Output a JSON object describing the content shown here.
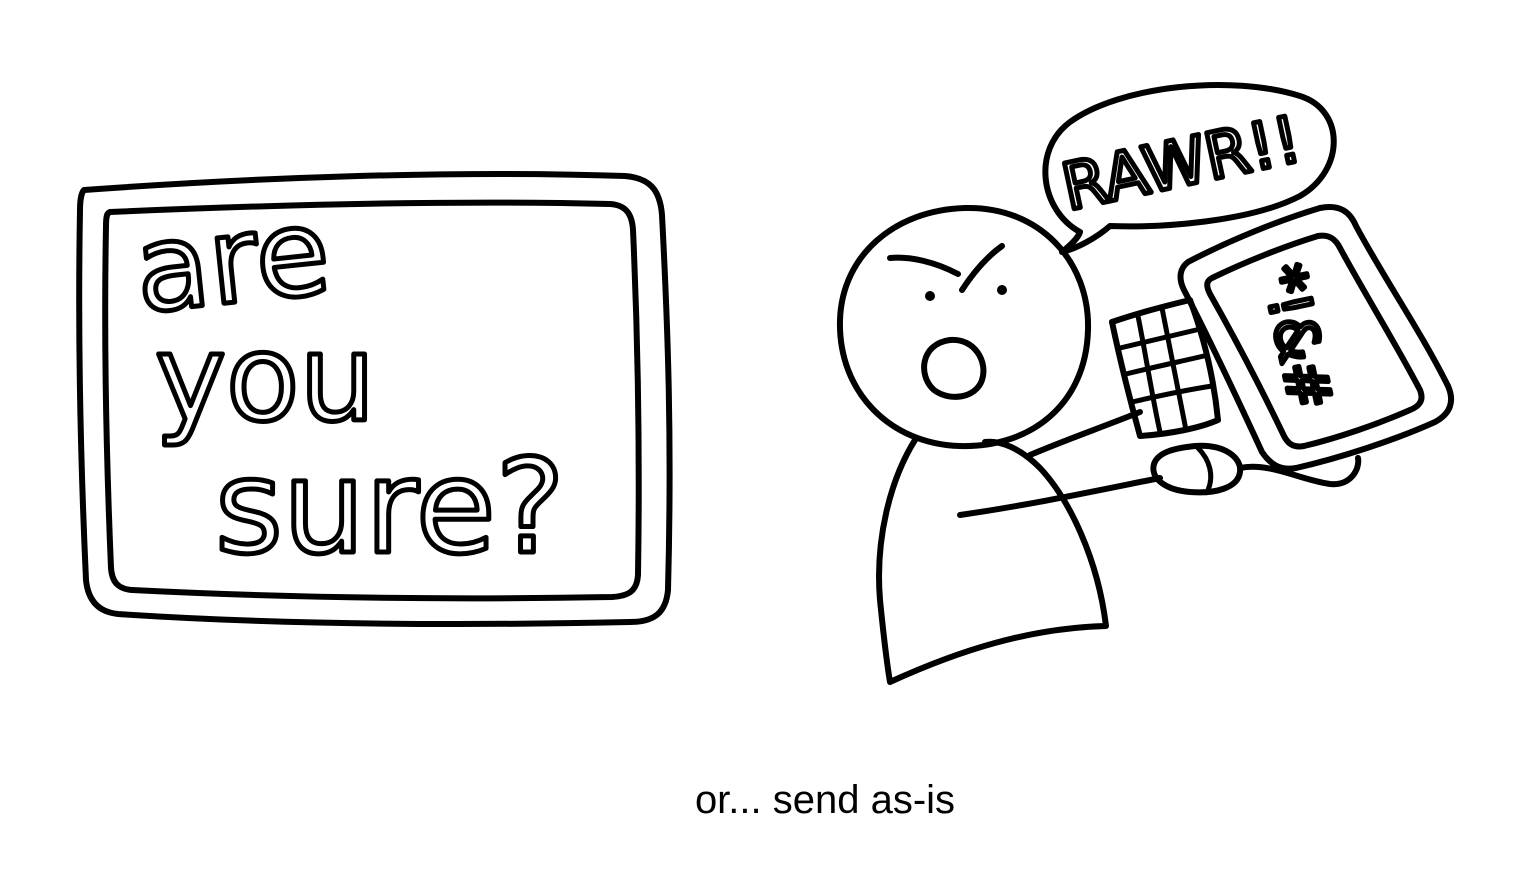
{
  "dialog_sketch": {
    "line1": "are",
    "line2": "you",
    "line3": "sure?"
  },
  "speech_bubble": {
    "text": "RAWR!!"
  },
  "monitor_screen": {
    "text": "*!&#"
  },
  "caption": {
    "text": "or... send as-is"
  },
  "colors": {
    "ink": "#000000",
    "background": "#ffffff"
  }
}
